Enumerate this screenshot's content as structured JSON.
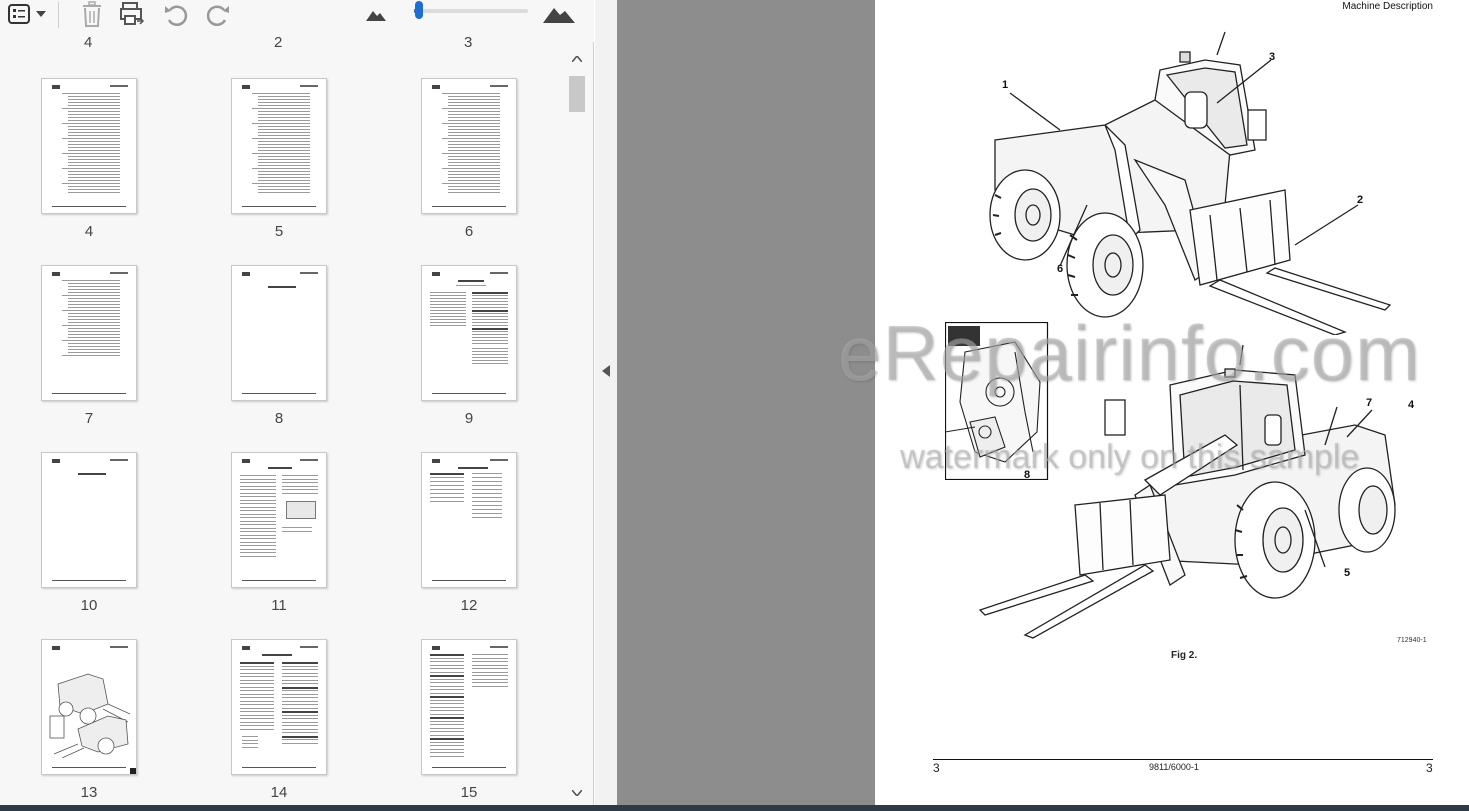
{
  "toolbar": {
    "icons": [
      "list-view-icon",
      "dropdown-caret-icon",
      "delete-icon",
      "print-pages-icon",
      "rotate-ccw-icon",
      "rotate-cw-icon",
      "zoom-out-mountain-icon",
      "zoom-in-mountain-icon"
    ],
    "zoom_level": 0.02
  },
  "thumbnails": {
    "partial_labels": [
      "4",
      "2",
      "3"
    ],
    "pages": [
      {
        "label": "4",
        "kind": "toc"
      },
      {
        "label": "5",
        "kind": "toc"
      },
      {
        "label": "6",
        "kind": "toc"
      },
      {
        "label": "7",
        "kind": "toc-short"
      },
      {
        "label": "8",
        "kind": "blank-center"
      },
      {
        "label": "9",
        "kind": "safety"
      },
      {
        "label": "10",
        "kind": "blank-center"
      },
      {
        "label": "11",
        "kind": "intro"
      },
      {
        "label": "12",
        "kind": "text-short"
      },
      {
        "label": "13",
        "kind": "figure"
      },
      {
        "label": "14",
        "kind": "text-mixed"
      },
      {
        "label": "15",
        "kind": "text-full"
      }
    ]
  },
  "page_view": {
    "section_title": "Machine Description",
    "callouts": [
      "1",
      "2",
      "3",
      "4",
      "5",
      "6",
      "7",
      "8"
    ],
    "figure_code": "712940-1",
    "figure_caption": "Fig 2.",
    "footer_left": "3",
    "footer_doc": "9811/6000-1",
    "footer_right": "3"
  },
  "watermark": {
    "main": "eRepairinfo.com",
    "sub": "watermark only on this sample"
  }
}
